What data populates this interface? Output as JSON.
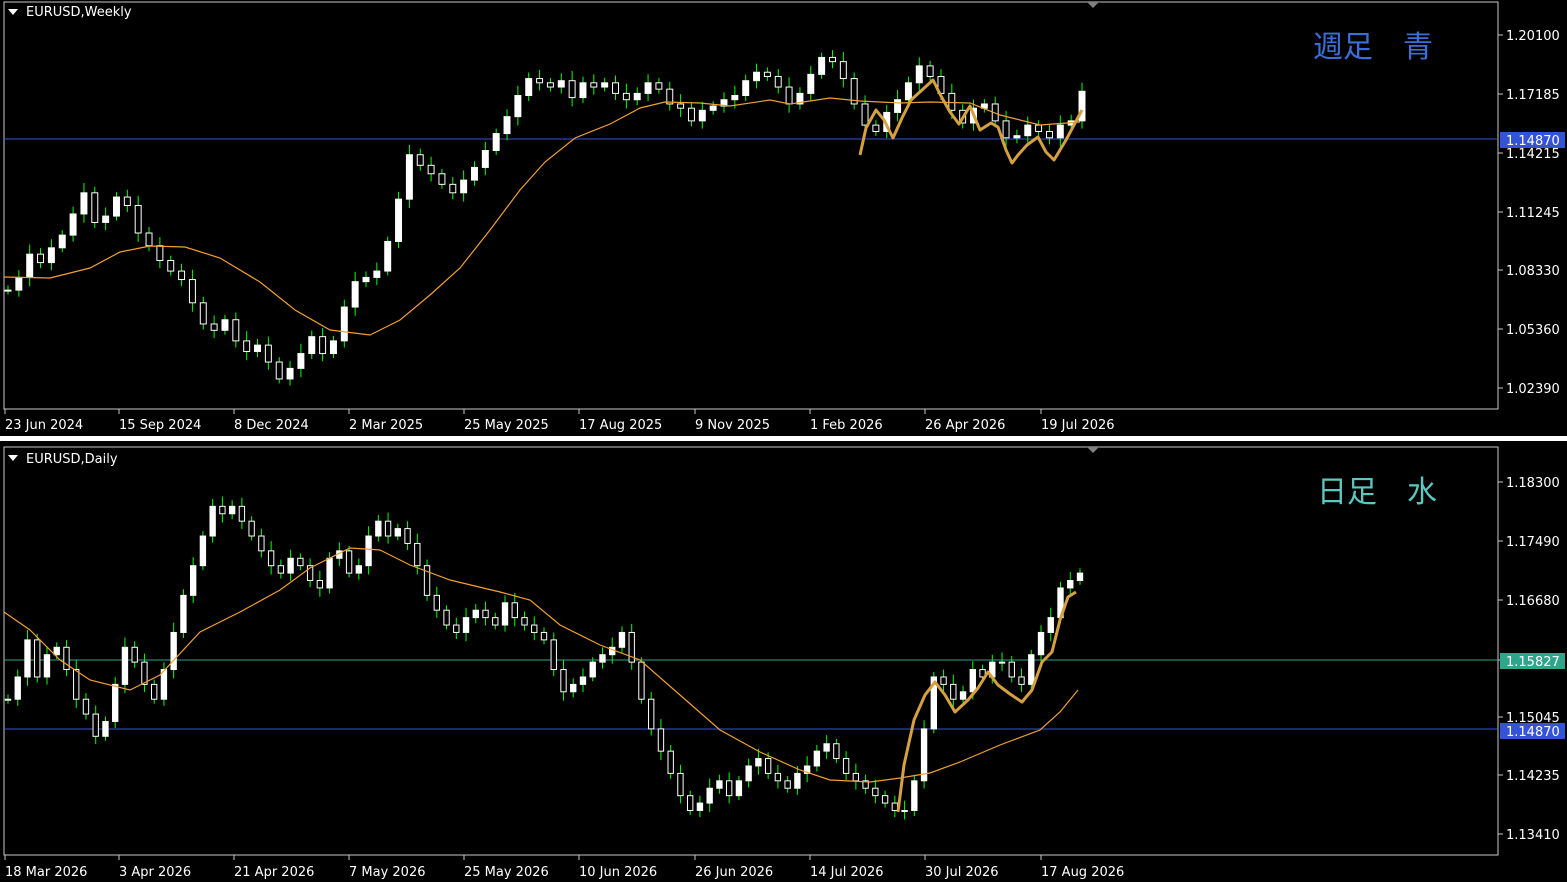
{
  "panes": [
    {
      "symbol_label": "EURUSD,Weekly",
      "overlay_label": "週足　青",
      "overlay_color": "#3a6fd8",
      "price_ticks": [
        "1.20100",
        "1.17185",
        "1.14215",
        "1.11245",
        "1.08330",
        "1.05360",
        "1.02390"
      ],
      "date_ticks": [
        "23 Jun 2024",
        "15 Sep 2024",
        "8 Dec 2024",
        "2 Mar 2025",
        "25 May 2025",
        "17 Aug 2025",
        "9 Nov 2025",
        "1 Feb 2026",
        "26 Apr 2026",
        "19 Jul 2026"
      ],
      "hlines": [
        {
          "label": "1.14870",
          "color": "#3553d6"
        }
      ]
    },
    {
      "symbol_label": "EURUSD,Daily",
      "overlay_label": "日足　水",
      "overlay_color": "#5ec8c0",
      "price_ticks": [
        "1.18300",
        "1.17490",
        "1.16680",
        "1.15865",
        "1.15045",
        "1.14235",
        "1.13410"
      ],
      "date_ticks": [
        "18 Mar 2026",
        "3 Apr 2026",
        "21 Apr 2026",
        "7 May 2026",
        "25 May 2026",
        "10 Jun 2026",
        "26 Jun 2026",
        "14 Jul 2026",
        "30 Jul 2026",
        "17 Aug 2026"
      ],
      "hlines": [
        {
          "label": "1.15827",
          "color": "#2fa58c"
        },
        {
          "label": "1.14870",
          "color": "#3553d6"
        }
      ]
    }
  ],
  "chart_data": [
    {
      "type": "candlestick",
      "title": "EURUSD,Weekly",
      "ylim": [
        1.0158,
        1.2082
      ],
      "x_range": [
        "23 Jun 2024",
        "19 Jul 2026"
      ],
      "price_levels": [
        1.1487
      ],
      "series": [
        {
          "kind": "candles",
          "up_color": "#ffffff",
          "down_color": "#ffffff",
          "wick_color": "#00ff00",
          "closes": [
            1.072,
            1.078,
            1.089,
            1.085,
            1.092,
            1.098,
            1.108,
            1.118,
            1.104,
            1.107,
            1.116,
            1.112,
            1.099,
            1.093,
            1.086,
            1.081,
            1.077,
            1.066,
            1.056,
            1.053,
            1.058,
            1.048,
            1.043,
            1.046,
            1.038,
            1.03,
            1.035,
            1.042,
            1.05,
            1.042,
            1.048,
            1.064,
            1.076,
            1.078,
            1.081,
            1.095,
            1.115,
            1.136,
            1.131,
            1.127,
            1.122,
            1.118,
            1.124,
            1.13,
            1.138,
            1.146,
            1.154,
            1.164,
            1.172,
            1.17,
            1.168,
            1.171,
            1.163,
            1.17,
            1.168,
            1.17,
            1.165,
            1.162,
            1.165,
            1.17,
            1.167,
            1.16,
            1.158,
            1.152,
            1.157,
            1.159,
            1.162,
            1.164,
            1.171,
            1.175,
            1.173,
            1.168,
            1.16,
            1.165,
            1.174,
            1.182,
            1.18,
            1.172,
            1.16,
            1.15,
            1.147,
            1.156,
            1.162,
            1.17,
            1.178,
            1.173,
            1.165,
            1.157,
            1.151,
            1.158,
            1.16,
            1.152,
            1.144,
            1.145,
            1.15,
            1.147,
            1.144,
            1.15,
            1.152,
            1.166
          ]
        },
        {
          "kind": "moving_average",
          "color": "#f0a030",
          "values": [
            1.08,
            1.08,
            1.08,
            1.085,
            1.09,
            1.095,
            1.095,
            1.09,
            1.08,
            1.07,
            1.058,
            1.052,
            1.052,
            1.06,
            1.08,
            1.1,
            1.122,
            1.14,
            1.152,
            1.16,
            1.166,
            1.169,
            1.17,
            1.168,
            1.169,
            1.166,
            1.168,
            1.169,
            1.168,
            1.16,
            1.152,
            1.152,
            1.152
          ]
        }
      ]
    },
    {
      "type": "candlestick",
      "title": "EURUSD,Daily",
      "ylim": [
        1.131,
        1.186
      ],
      "x_range": [
        "18 Mar 2026",
        "17 Aug 2026"
      ],
      "price_levels": [
        1.15827,
        1.1487
      ],
      "series": [
        {
          "kind": "candles",
          "up_color": "#ffffff",
          "down_color": "#ffffff",
          "wick_color": "#00ff00",
          "closes": [
            1.152,
            1.155,
            1.16,
            1.155,
            1.158,
            1.159,
            1.156,
            1.152,
            1.15,
            1.147,
            1.149,
            1.154,
            1.159,
            1.157,
            1.154,
            1.152,
            1.156,
            1.161,
            1.166,
            1.17,
            1.174,
            1.178,
            1.177,
            1.178,
            1.176,
            1.174,
            1.172,
            1.17,
            1.169,
            1.171,
            1.17,
            1.168,
            1.167,
            1.171,
            1.172,
            1.169,
            1.17,
            1.174,
            1.176,
            1.174,
            1.175,
            1.173,
            1.17,
            1.166,
            1.164,
            1.162,
            1.161,
            1.163,
            1.164,
            1.163,
            1.162,
            1.165,
            1.163,
            1.162,
            1.161,
            1.16,
            1.156,
            1.153,
            1.154,
            1.155,
            1.157,
            1.158,
            1.159,
            1.161,
            1.157,
            1.152,
            1.148,
            1.145,
            1.142,
            1.139,
            1.137,
            1.138,
            1.14,
            1.141,
            1.139,
            1.141,
            1.143,
            1.144,
            1.142,
            1.141,
            1.14,
            1.142,
            1.143,
            1.145,
            1.146,
            1.144,
            1.142,
            1.141,
            1.14,
            1.139,
            1.138,
            1.137,
            1.137,
            1.141,
            1.148,
            1.155,
            1.154,
            1.152,
            1.153,
            1.156,
            1.155,
            1.157,
            1.157,
            1.155,
            1.154,
            1.158,
            1.161,
            1.163,
            1.167,
            1.168,
            1.169
          ]
        },
        {
          "kind": "moving_average",
          "color": "#f0a030",
          "values": [
            1.163,
            1.161,
            1.158,
            1.155,
            1.155,
            1.157,
            1.162,
            1.166,
            1.169,
            1.172,
            1.173,
            1.173,
            1.17,
            1.168,
            1.167,
            1.166,
            1.163,
            1.16,
            1.156,
            1.151,
            1.146,
            1.143,
            1.141,
            1.141,
            1.141,
            1.14,
            1.142,
            1.144,
            1.146,
            1.148,
            1.15,
            1.152,
            1.156
          ]
        }
      ]
    }
  ]
}
